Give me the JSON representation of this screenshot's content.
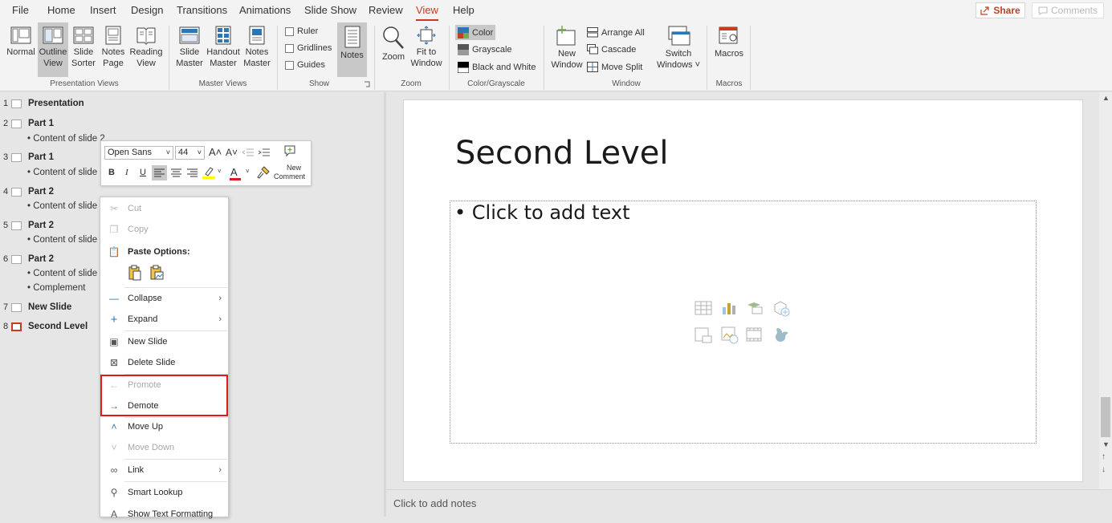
{
  "menu": {
    "tabs": [
      "File",
      "Home",
      "Insert",
      "Design",
      "Transitions",
      "Animations",
      "Slide Show",
      "Review",
      "View",
      "Help"
    ],
    "active_tab": "View",
    "share": "Share",
    "comments": "Comments"
  },
  "ribbon": {
    "presentation_views": {
      "normal": "Normal",
      "outline_l1": "Outline",
      "outline_l2": "View",
      "sorter_l1": "Slide",
      "sorter_l2": "Sorter",
      "notes_l1": "Notes",
      "notes_l2": "Page",
      "reading_l1": "Reading",
      "reading_l2": "View",
      "label": "Presentation Views"
    },
    "master_views": {
      "slide_l1": "Slide",
      "slide_l2": "Master",
      "handout_l1": "Handout",
      "handout_l2": "Master",
      "notes_l1": "Notes",
      "notes_l2": "Master",
      "label": "Master Views"
    },
    "show": {
      "ruler": "Ruler",
      "gridlines": "Gridlines",
      "guides": "Guides",
      "notes": "Notes",
      "label": "Show"
    },
    "zoom": {
      "zoom": "Zoom",
      "fit_l1": "Fit to",
      "fit_l2": "Window",
      "label": "Zoom"
    },
    "color": {
      "color": "Color",
      "grayscale": "Grayscale",
      "bw": "Black and White",
      "label": "Color/Grayscale"
    },
    "window": {
      "new_l1": "New",
      "new_l2": "Window",
      "arrange": "Arrange All",
      "cascade": "Cascade",
      "move_split": "Move Split",
      "switch_l1": "Switch",
      "switch_l2": "Windows ˅",
      "label": "Window"
    },
    "macros": {
      "macros": "Macros",
      "label": "Macros"
    }
  },
  "outline": [
    {
      "num": "1",
      "title": "Presentation",
      "bullets": []
    },
    {
      "num": "2",
      "title": "Part 1",
      "bullets": [
        "• Content of slide 2"
      ]
    },
    {
      "num": "3",
      "title": "Part 1",
      "bullets": [
        "• Content of slide"
      ]
    },
    {
      "num": "4",
      "title": "Part 2",
      "bullets": [
        "• Content of slide"
      ]
    },
    {
      "num": "5",
      "title": "Part 2",
      "bullets": [
        "• Content of slide"
      ]
    },
    {
      "num": "6",
      "title": "Part 2",
      "bullets": [
        "• Content of slide",
        "• Complement"
      ]
    },
    {
      "num": "7",
      "title": "New Slide",
      "bullets": []
    },
    {
      "num": "8",
      "title": "Second Level",
      "bullets": []
    }
  ],
  "mini_toolbar": {
    "font": "Open Sans",
    "size": "44",
    "new_comment_l1": "New",
    "new_comment_l2": "Comment"
  },
  "context_menu": {
    "cut": "Cut",
    "copy": "Copy",
    "paste_options": "Paste Options:",
    "collapse": "Collapse",
    "expand": "Expand",
    "new_slide": "New Slide",
    "delete_slide": "Delete Slide",
    "promote": "Promote",
    "demote": "Demote",
    "move_up": "Move Up",
    "move_down": "Move Down",
    "link": "Link",
    "smart_lookup": "Smart Lookup",
    "show_text_formatting": "Show Text Formatting"
  },
  "slide": {
    "title": "Second Level",
    "content_placeholder": "• Click to add text"
  },
  "notes": {
    "placeholder": "Click to add notes"
  },
  "colors": {
    "accent": "#c43e1c",
    "highlight_box": "#e0191a"
  }
}
